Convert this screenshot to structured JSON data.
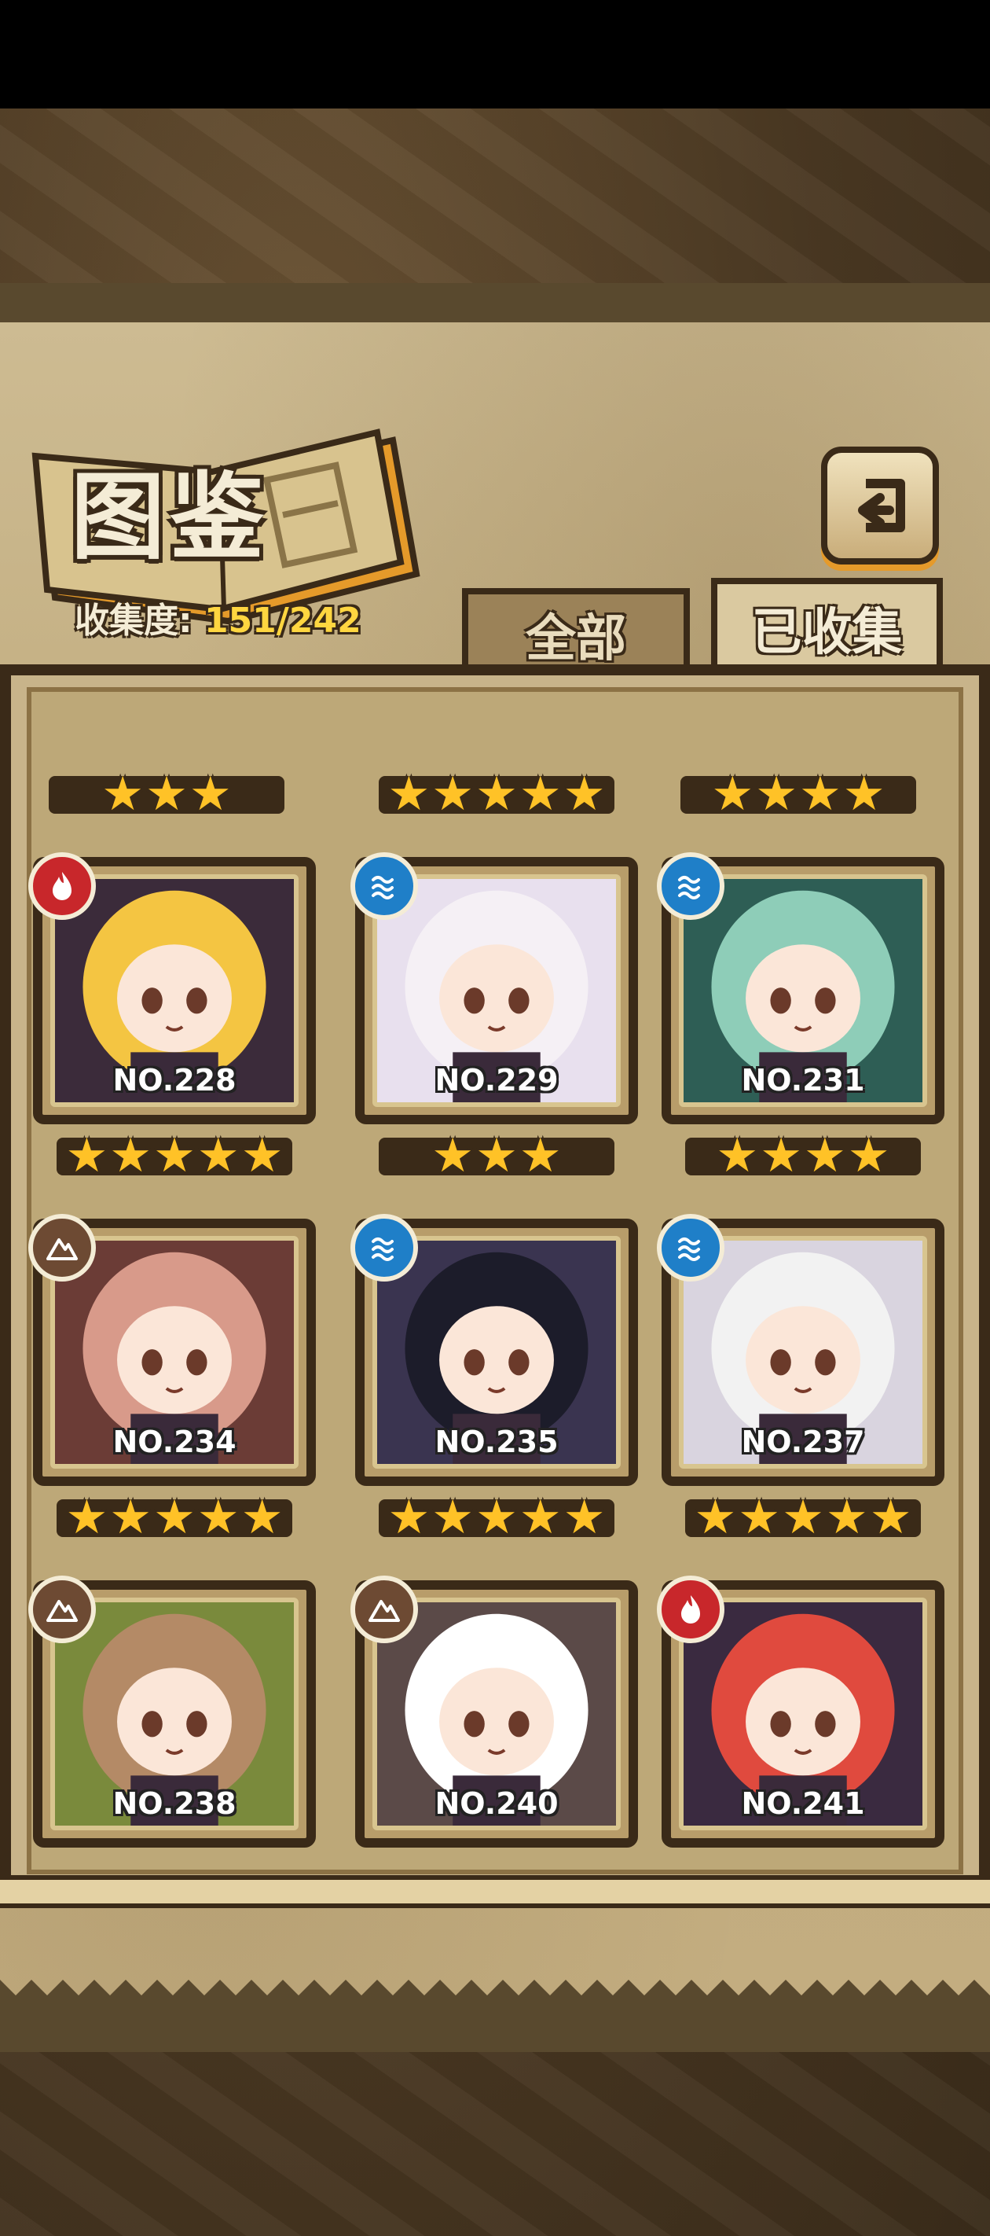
{
  "header": {
    "title": "图鉴",
    "collection_label": "收集度:",
    "collection_value": "151/242"
  },
  "tabs": [
    {
      "label": "全部",
      "selected": false
    },
    {
      "label": "已收集",
      "selected": true
    }
  ],
  "partial_row_stars": [
    3,
    5,
    4
  ],
  "cards": [
    {
      "number": "NO.228",
      "element": "fire",
      "stars": 5,
      "hair": "#f4c542",
      "bg": "#3b2b3a"
    },
    {
      "number": "NO.229",
      "element": "water",
      "stars": 3,
      "hair": "#f5f0f5",
      "bg": "#e8e0ee"
    },
    {
      "number": "NO.231",
      "element": "water",
      "stars": 4,
      "hair": "#8ecdb8",
      "bg": "#2e5e55"
    },
    {
      "number": "NO.234",
      "element": "earth",
      "stars": 5,
      "hair": "#d89a8a",
      "bg": "#6b3c36"
    },
    {
      "number": "NO.235",
      "element": "water",
      "stars": 5,
      "hair": "#1c1c2a",
      "bg": "#3a3450"
    },
    {
      "number": "NO.237",
      "element": "water",
      "stars": 5,
      "hair": "#f2f2f2",
      "bg": "#d9d4df"
    },
    {
      "number": "NO.238",
      "element": "earth",
      "stars": 0,
      "hair": "#b48a66",
      "bg": "#7a8a3c"
    },
    {
      "number": "NO.240",
      "element": "earth",
      "stars": 0,
      "hair": "#ffffff",
      "bg": "#5b4a48"
    },
    {
      "number": "NO.241",
      "element": "fire",
      "stars": 0,
      "hair": "#e04a3e",
      "bg": "#3a2a40"
    }
  ],
  "colors": {
    "fire": "#c8272b",
    "water": "#1f7fc8",
    "earth": "#6d4a33",
    "star": "#ffc227"
  }
}
